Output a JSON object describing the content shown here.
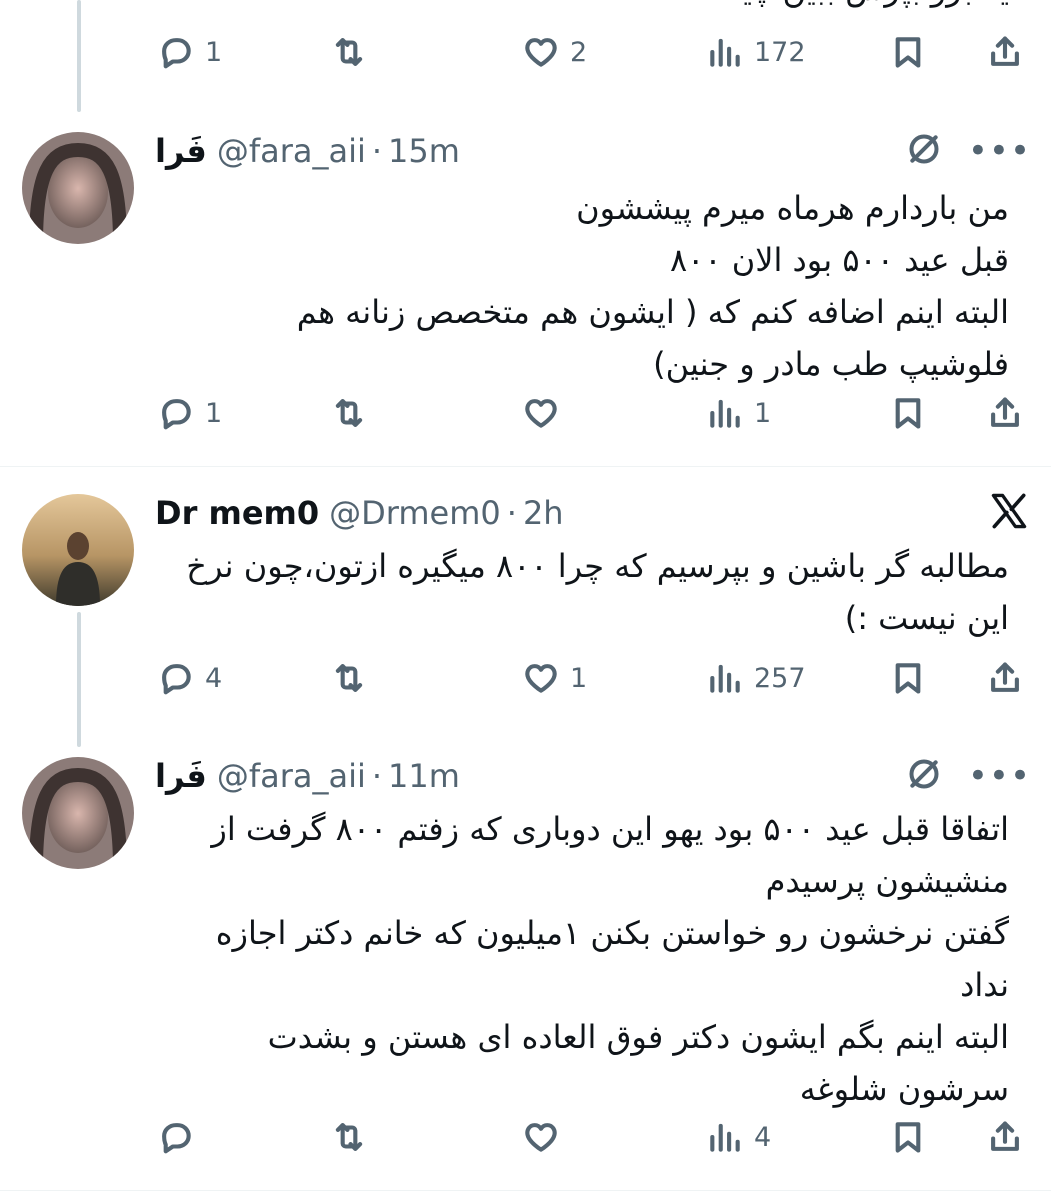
{
  "top_partial": {
    "text": "یه برو بپرس ببین چیه",
    "actions": {
      "replies": "1",
      "retweets": "",
      "likes": "2",
      "views": "172"
    }
  },
  "tweets": [
    {
      "display_name": "فَرا",
      "handle": "@fara_aii",
      "dot": "·",
      "time": "15m",
      "body": "من باردارم هرماه میرم پیششون\nقبل عید ۵۰۰ بود الان ۸۰۰\nالبته اینم اضافه کنم که ( ایشون هم متخصص زنانه هم\nفلوشیپ طب مادر و جنین)",
      "actions": {
        "replies": "1",
        "retweets": "",
        "likes": "",
        "views": "1"
      }
    },
    {
      "display_name": "Dr mem0",
      "handle": "@Drmem0",
      "dot": "·",
      "time": "2h",
      "body": "مطالبه گر باشین و بپرسیم که چرا ۸۰۰ میگیره ازتون،چون نرخ\nاین نیست :)",
      "actions": {
        "replies": "4",
        "retweets": "",
        "likes": "1",
        "views": "257"
      }
    },
    {
      "display_name": "فَرا",
      "handle": "@fara_aii",
      "dot": "·",
      "time": "11m",
      "body": "اتفاقا قبل عید ۵۰۰ بود یهو این دوباری که زفتم ۸۰۰ گرفت از\nمنشیشون پرسیدم\nگفتن نرخشون رو خواستن بکنن ۱میلیون که خانم دکتر اجازه\nنداد\nالبته اینم بگم ایشون دکتر فوق العاده ای هستن و بشدت\nسرشون شلوغه",
      "actions": {
        "replies": "",
        "retweets": "",
        "likes": "",
        "views": "4"
      }
    }
  ],
  "icons": {
    "reply": "reply-icon",
    "retweet": "retweet-icon",
    "like": "heart-icon",
    "views": "views-icon",
    "bookmark": "bookmark-icon",
    "share": "share-icon",
    "grok": "grok-icon",
    "more": "more-icon",
    "x_logo": "x-logo-icon"
  },
  "colors": {
    "text": "#0f1419",
    "secondary": "#536471",
    "thread_line": "#cfd9de",
    "divider": "#eff3f4"
  }
}
